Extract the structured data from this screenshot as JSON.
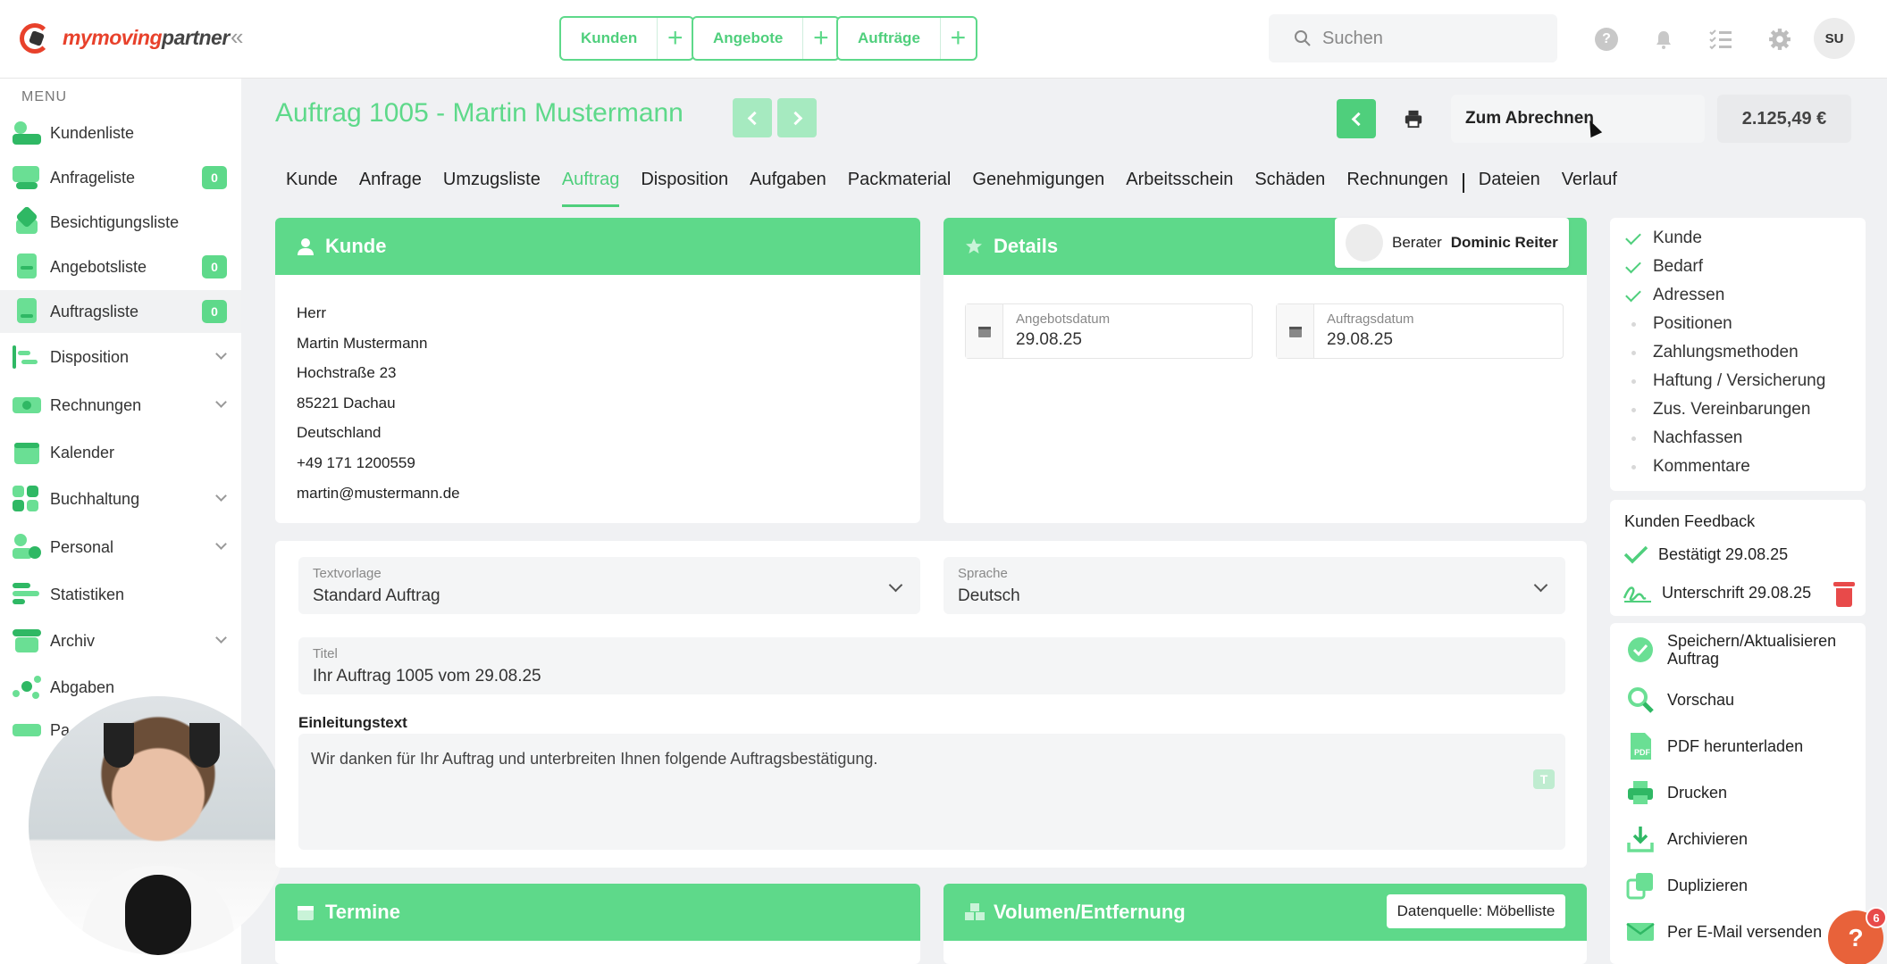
{
  "brand": {
    "name_part1": "mymoving",
    "name_part2": "partner"
  },
  "quick_actions": [
    {
      "label": "Kunden"
    },
    {
      "label": "Angebote"
    },
    {
      "label": "Aufträge"
    }
  ],
  "search": {
    "placeholder": "Suchen"
  },
  "user": {
    "initials": "SU"
  },
  "sidebar": {
    "heading": "MENU",
    "items": [
      {
        "label": "Kundenliste"
      },
      {
        "label": "Anfrageliste",
        "badge": "0"
      },
      {
        "label": "Besichtigungsliste"
      },
      {
        "label": "Angebotsliste",
        "badge": "0"
      },
      {
        "label": "Auftragsliste",
        "badge": "0"
      },
      {
        "label": "Disposition"
      },
      {
        "label": "Rechnungen"
      },
      {
        "label": "Kalender"
      },
      {
        "label": "Buchhaltung"
      },
      {
        "label": "Personal"
      },
      {
        "label": "Statistiken"
      },
      {
        "label": "Archiv"
      },
      {
        "label": "Abgaben"
      },
      {
        "label": "Pa"
      }
    ]
  },
  "header": {
    "title": "Auftrag 1005 - Martin Mustermann",
    "bill_label": "Zum Abrechnen",
    "price": "2.125,49 €"
  },
  "tabs": [
    "Kunde",
    "Anfrage",
    "Umzugsliste",
    "Auftrag",
    "Disposition",
    "Aufgaben",
    "Packmaterial",
    "Genehmigungen",
    "Arbeitsschein",
    "Schäden",
    "Rechnungen",
    "Dateien",
    "Verlauf"
  ],
  "customer": {
    "heading": "Kunde",
    "lines": [
      "Herr",
      "Martin Mustermann",
      "Hochstraße 23",
      "85221 Dachau",
      "Deutschland",
      "+49 171 1200559",
      "martin@mustermann.de"
    ]
  },
  "details": {
    "heading": "Details",
    "berater_label": "Berater",
    "berater_name": "Dominic Reiter",
    "offer_date_label": "Angebotsdatum",
    "offer_date": "29.08.25",
    "order_date_label": "Auftragsdatum",
    "order_date": "29.08.25"
  },
  "form": {
    "template_label": "Textvorlage",
    "template_value": "Standard Auftrag",
    "language_label": "Sprache",
    "language_value": "Deutsch",
    "title_label": "Titel",
    "title_value": "Ihr Auftrag 1005 vom 29.08.25",
    "intro_label": "Einleitungstext",
    "intro_text": "Wir danken für Ihr Auftrag und unterbreiten Ihnen folgende Auftragsbestätigung.",
    "t_button": "T"
  },
  "termine": {
    "heading": "Termine"
  },
  "volumen": {
    "heading": "Volumen/Entfernung",
    "source_label": "Datenquelle: Möbelliste"
  },
  "checklist": [
    {
      "label": "Kunde",
      "done": true
    },
    {
      "label": "Bedarf",
      "done": true
    },
    {
      "label": "Adressen",
      "done": true
    },
    {
      "label": "Positionen",
      "done": false
    },
    {
      "label": "Zahlungsmethoden",
      "done": false
    },
    {
      "label": "Haftung / Versicherung",
      "done": false
    },
    {
      "label": "Zus. Vereinbarungen",
      "done": false
    },
    {
      "label": "Nachfassen",
      "done": false
    },
    {
      "label": "Kommentare",
      "done": false
    }
  ],
  "feedback": {
    "title": "Kunden Feedback",
    "confirmed": "Bestätigt 29.08.25",
    "signature": "Unterschrift 29.08.25"
  },
  "actions": {
    "save": "Speichern/Aktualisieren Auftrag",
    "preview": "Vorschau",
    "pdf": "PDF herunterladen",
    "print": "Drucken",
    "archive": "Archivieren",
    "duplicate": "Duplizieren",
    "email": "Per E-Mail versenden"
  },
  "help": {
    "label": "?",
    "count": "6"
  },
  "colors": {
    "accent": "#5ed98a",
    "accent_dark": "#2fb864",
    "danger": "#e84a4a",
    "brand_red": "#e8412b"
  }
}
